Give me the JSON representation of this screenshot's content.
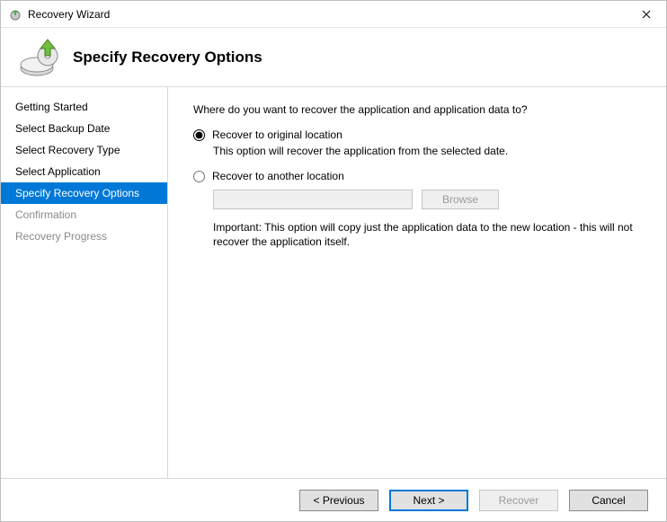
{
  "window": {
    "title": "Recovery Wizard"
  },
  "header": {
    "title": "Specify Recovery Options"
  },
  "sidebar": {
    "items": [
      {
        "label": "Getting Started",
        "state": "completed"
      },
      {
        "label": "Select Backup Date",
        "state": "completed"
      },
      {
        "label": "Select Recovery Type",
        "state": "completed"
      },
      {
        "label": "Select Application",
        "state": "completed"
      },
      {
        "label": "Specify Recovery Options",
        "state": "active"
      },
      {
        "label": "Confirmation",
        "state": "pending"
      },
      {
        "label": "Recovery Progress",
        "state": "pending"
      }
    ]
  },
  "content": {
    "prompt": "Where do you want to recover the application and application data to?",
    "option1": {
      "label": "Recover to original location",
      "desc": "This option will recover the application from the selected date.",
      "selected": true
    },
    "option2": {
      "label": "Recover to another location",
      "selected": false,
      "path_value": "",
      "browse_label": "Browse",
      "important": "Important: This option will copy just the application data to the new location - this will not recover the application itself."
    }
  },
  "footer": {
    "previous": "< Previous",
    "next": "Next >",
    "recover": "Recover",
    "cancel": "Cancel"
  }
}
